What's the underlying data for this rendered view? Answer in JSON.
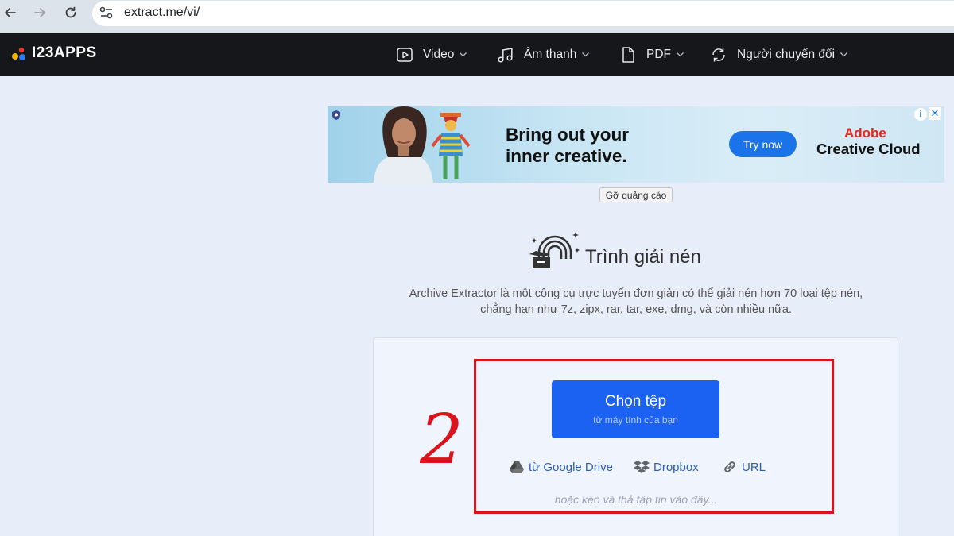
{
  "browser": {
    "url": "extract.me/vi/",
    "back_icon": "arrow-left",
    "forward_icon": "arrow-right",
    "reload_icon": "reload",
    "site_settings_icon": "tune"
  },
  "header": {
    "logo_text": "I23APPS",
    "nav": [
      {
        "label": "Video",
        "icon": "video-play"
      },
      {
        "label": "Âm thanh",
        "icon": "music-note"
      },
      {
        "label": "PDF",
        "icon": "document"
      },
      {
        "label": "Người chuyển đổi",
        "icon": "convert-arrows"
      }
    ]
  },
  "ad": {
    "headline_1": "Bring out your",
    "headline_2": "inner creative.",
    "cta": "Try now",
    "brand_1": "Adobe",
    "brand_2": "Creative Cloud",
    "info": "i",
    "close": "✕",
    "remove_ads": "Gỡ quảng cáo"
  },
  "main": {
    "title": "Trình giải nén",
    "description_1": "Archive Extractor là một công cụ trực tuyến đơn giản có thể giải nén hơn 70 loại tệp nén,",
    "description_2": "chẳng hạn như 7z, zipx, rar, tar, exe, dmg, và còn nhiều nữa."
  },
  "upload": {
    "choose_label": "Chọn tệp",
    "choose_sub": "từ máy tính của bạn",
    "google_drive": "từ Google Drive",
    "dropbox": "Dropbox",
    "url": "URL",
    "drop_hint": "hoặc kéo và thả tập tin vào đây...",
    "annotation_number": "2"
  },
  "colors": {
    "page_bg": "#e7edf9",
    "header_bg": "#16171b",
    "primary": "#1b62f2",
    "link": "#2c5fb3",
    "annotation_red": "#d9141e"
  }
}
